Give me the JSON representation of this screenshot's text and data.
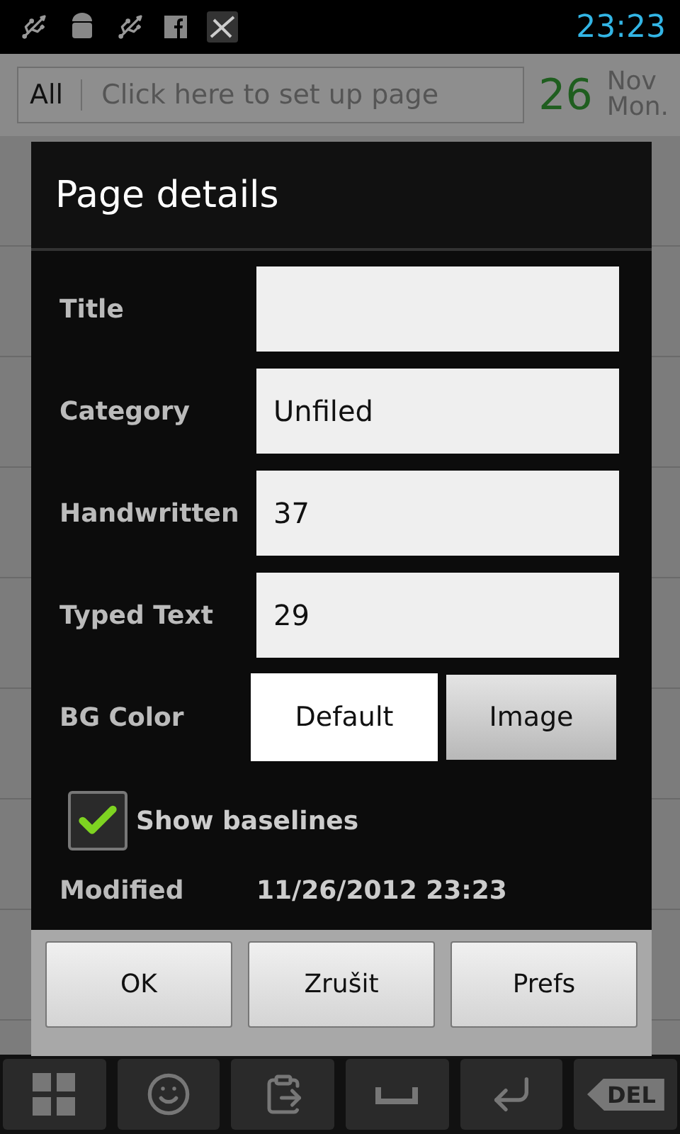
{
  "status_bar": {
    "time": "23:23"
  },
  "app": {
    "category": "All",
    "page_placeholder": "Click here to set up page",
    "day": "26",
    "month": "Nov",
    "weekday": "Mon."
  },
  "dialog": {
    "title": "Page details",
    "fields": [
      {
        "label": "Title"
      },
      {
        "label": "Category",
        "value": "Unfiled"
      },
      {
        "label": "Handwritten",
        "value": "37"
      },
      {
        "label": "Typed Text",
        "value": "29"
      }
    ],
    "bg_color": {
      "label": "BG Color",
      "options": [
        {
          "label": "Default",
          "selected": true
        },
        {
          "label": "Image",
          "selected": false
        }
      ]
    },
    "show_baselines": {
      "label": "Show baselines",
      "checked": true
    },
    "modified": {
      "label": "Modified",
      "value": "11/26/2012 23:23"
    },
    "buttons": [
      "OK",
      "Zrušit",
      "Prefs"
    ]
  },
  "keyboard": [
    {
      "kind": "grid"
    },
    {
      "kind": "smiley"
    },
    {
      "kind": "clipboard"
    },
    {
      "kind": "space"
    },
    {
      "kind": "enter"
    },
    {
      "kind": "delete",
      "label": "DEL"
    }
  ]
}
